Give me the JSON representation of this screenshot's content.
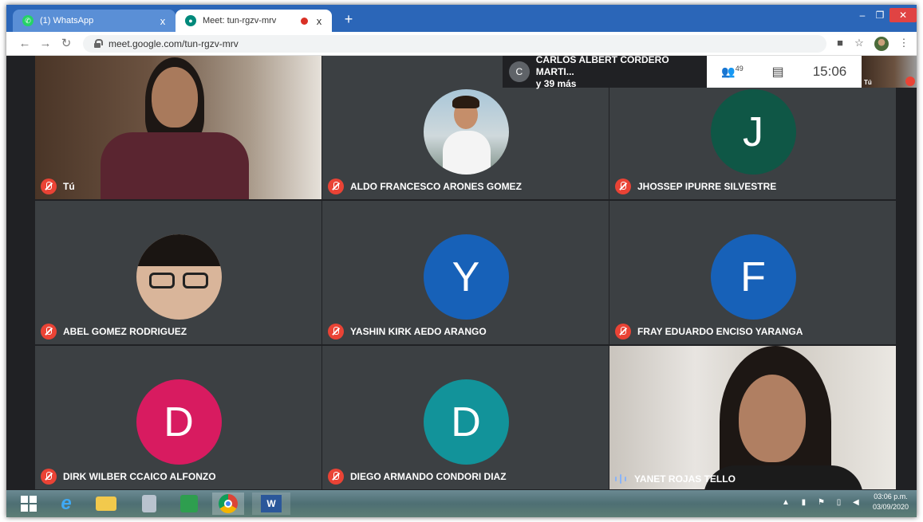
{
  "browser": {
    "tabs": [
      {
        "title": "(1) WhatsApp",
        "active": false,
        "icon": "whatsapp-icon",
        "color": "#25d366"
      },
      {
        "title": "Meet: tun-rgzv-mrv",
        "active": true,
        "icon": "meet-icon",
        "color": "#00897b"
      }
    ],
    "url": "meet.google.com/tun-rgzv-mrv",
    "new_tab": "+",
    "close_glyph": "x"
  },
  "meeting": {
    "host": {
      "initial": "C",
      "name": "CARLOS ALBERT CORDERO MARTI...",
      "others": "y 39 más"
    },
    "participants_count": "49",
    "time": "15:06",
    "self_label": "Tú"
  },
  "tiles": [
    {
      "name": "Tú",
      "type": "video-self",
      "muted": true
    },
    {
      "name": "ALDO FRANCESCO ARONES GOMEZ",
      "type": "photo",
      "muted": true
    },
    {
      "name": "JHOSSEP IPURRE SILVESTRE",
      "type": "initial",
      "initial": "J",
      "color": "#0f5746",
      "muted": true
    },
    {
      "name": "ABEL GOMEZ RODRIGUEZ",
      "type": "photo2",
      "muted": true
    },
    {
      "name": "YASHIN KIRK AEDO ARANGO",
      "type": "initial",
      "initial": "Y",
      "color": "#1761b8",
      "muted": true
    },
    {
      "name": "FRAY EDUARDO ENCISO YARANGA",
      "type": "initial",
      "initial": "F",
      "color": "#1761b8",
      "muted": true
    },
    {
      "name": "DIRK WILBER CCAICO ALFONZO",
      "type": "initial",
      "initial": "D",
      "color": "#d81b60",
      "muted": true
    },
    {
      "name": "DIEGO ARMANDO CONDORI DIAZ",
      "type": "initial",
      "initial": "D",
      "color": "#12939a",
      "muted": true
    },
    {
      "name": "YANET ROJAS TELLO",
      "type": "video-yanet",
      "muted": false
    }
  ],
  "taskbar": {
    "time": "03:06 p.m.",
    "date": "03/09/2020",
    "apps": [
      "start-icon",
      "ie-icon",
      "explorer-icon",
      "calculator-icon",
      "store-icon",
      "chrome-icon",
      "word-icon"
    ]
  }
}
